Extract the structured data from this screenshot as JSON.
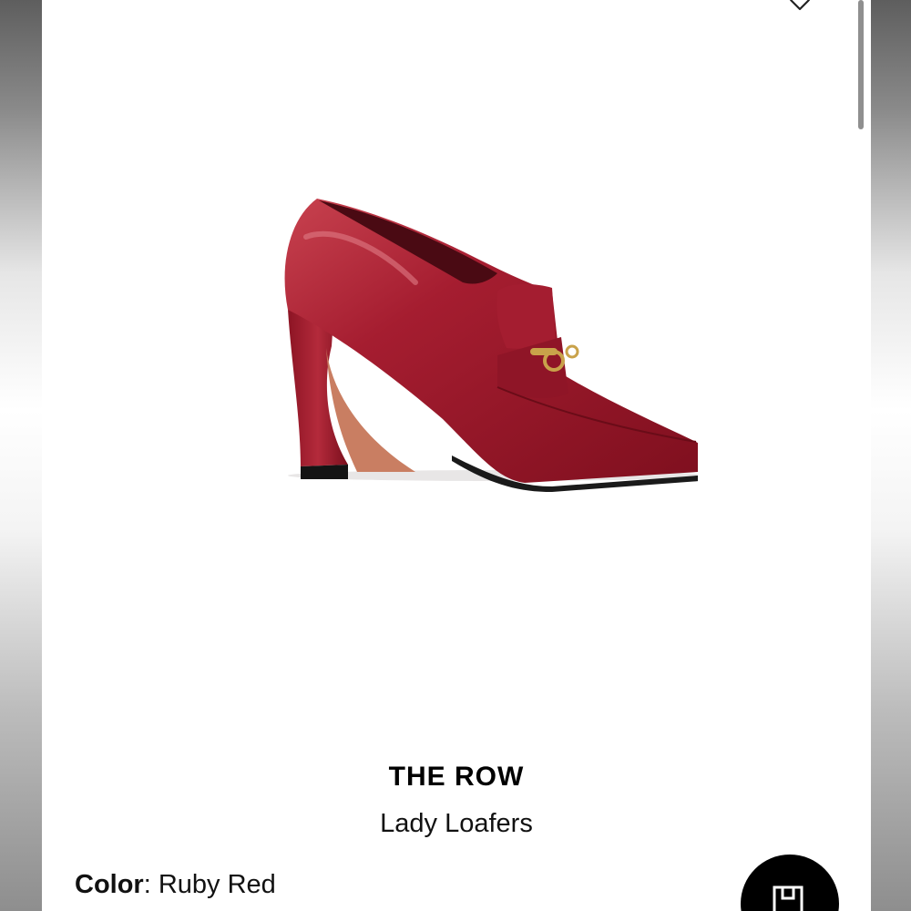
{
  "product": {
    "brand": "THE ROW",
    "name": "Lady Loafers",
    "color_label": "Color",
    "color_separator": ": ",
    "color_value": "Ruby Red"
  },
  "icons": {
    "wishlist": "heart-icon",
    "fab": "shopping-bag-icon"
  },
  "colors": {
    "shoe": "#9b1628",
    "shoe_highlight": "#c8424f",
    "hardware": "#c9a24a",
    "button": "#000000"
  }
}
